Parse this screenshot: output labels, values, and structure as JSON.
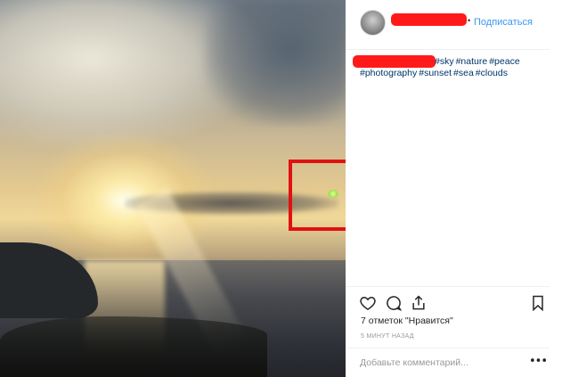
{
  "header": {
    "separator": "•",
    "follow_label": "Подписаться"
  },
  "caption": {
    "hashtags": [
      "#sky",
      "#nature",
      "#peace",
      "#photography",
      "#sunset",
      "#sea",
      "#clouds"
    ]
  },
  "actions": {
    "icons": [
      "heart-icon",
      "comment-icon",
      "share-icon",
      "bookmark-icon"
    ]
  },
  "likes_text": "7 отметок \"Нравится\"",
  "timestamp": "5 МИНУТ НАЗАД",
  "comment": {
    "placeholder": "Добавьте комментарий...",
    "more_label": "•••"
  },
  "colors": {
    "link": "#3897f0",
    "hashtag": "#003569",
    "redaction": "#ff1a1a",
    "highlight_box": "#e01111"
  }
}
